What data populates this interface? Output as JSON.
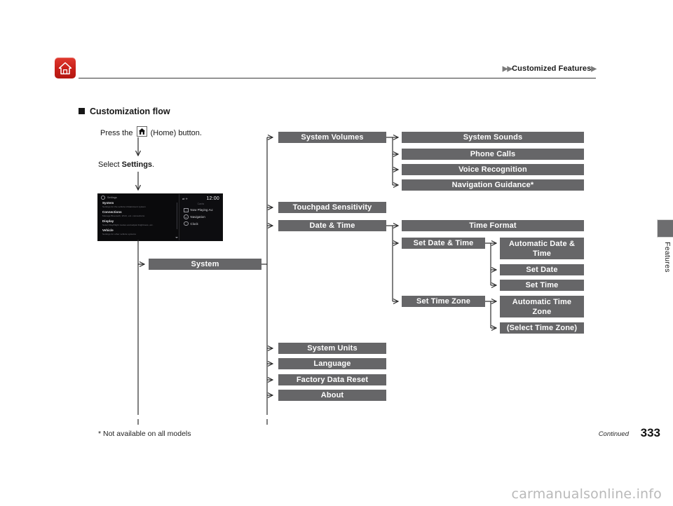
{
  "header": {
    "home_icon": "home-icon",
    "breadcrumb_prefix": "▶▶",
    "breadcrumb_text": "Customized Features",
    "breadcrumb_suffix": "▶"
  },
  "section": {
    "heading": "Customization flow"
  },
  "steps": {
    "press_prefix": "Press the",
    "press_suffix": "(Home) button.",
    "select_prefix": "Select",
    "select_bold": "Settings",
    "select_suffix": "."
  },
  "device_screenshot": {
    "topbar_label": "Settings",
    "status_clock": "12:00",
    "status_icons": "⇄  ✈",
    "cards_label": "Cards",
    "menu": [
      {
        "title": "System",
        "sub": "Settings for the vehicle infotainment system"
      },
      {
        "title": "Connections",
        "sub": "Manage Bluetooth, Wi-Fi, etc. connections"
      },
      {
        "title": "Display",
        "sub": "Select Day/Night modes and adjust brightness, etc."
      },
      {
        "title": "Vehicle",
        "sub": "Settings for other vehicle systems"
      }
    ],
    "cards": [
      {
        "label": "Now Playing Au:",
        "icon": "media-icon"
      },
      {
        "label": "Navigation",
        "icon": "navigation-icon"
      },
      {
        "label": "Clock",
        "icon": "clock-icon"
      }
    ]
  },
  "flow": {
    "root": "System",
    "level2": [
      "System Volumes",
      "Touchpad Sensitivity",
      "Date & Time",
      "System Units",
      "Language",
      "Factory Data Reset",
      "About"
    ],
    "system_volumes_children": [
      "System Sounds",
      "Phone Calls",
      "Voice Recognition",
      "Navigation Guidance*"
    ],
    "date_time_children": [
      "Time Format",
      "Set Date & Time",
      "Set Time Zone"
    ],
    "set_date_time_children": [
      "Automatic Date & Time",
      "Set Date",
      "Set Time"
    ],
    "set_time_zone_children": [
      "Automatic Time Zone",
      "(Select Time Zone)"
    ]
  },
  "side_tab": {
    "label": "Features"
  },
  "footer": {
    "footnote": "* Not available on all models",
    "continued": "Continued",
    "page_number": "333",
    "watermark": "carmanualsonline.info"
  },
  "colors": {
    "node_fill": "#666668",
    "accent_red": "#c9201a",
    "line": "#3a3a3a"
  }
}
